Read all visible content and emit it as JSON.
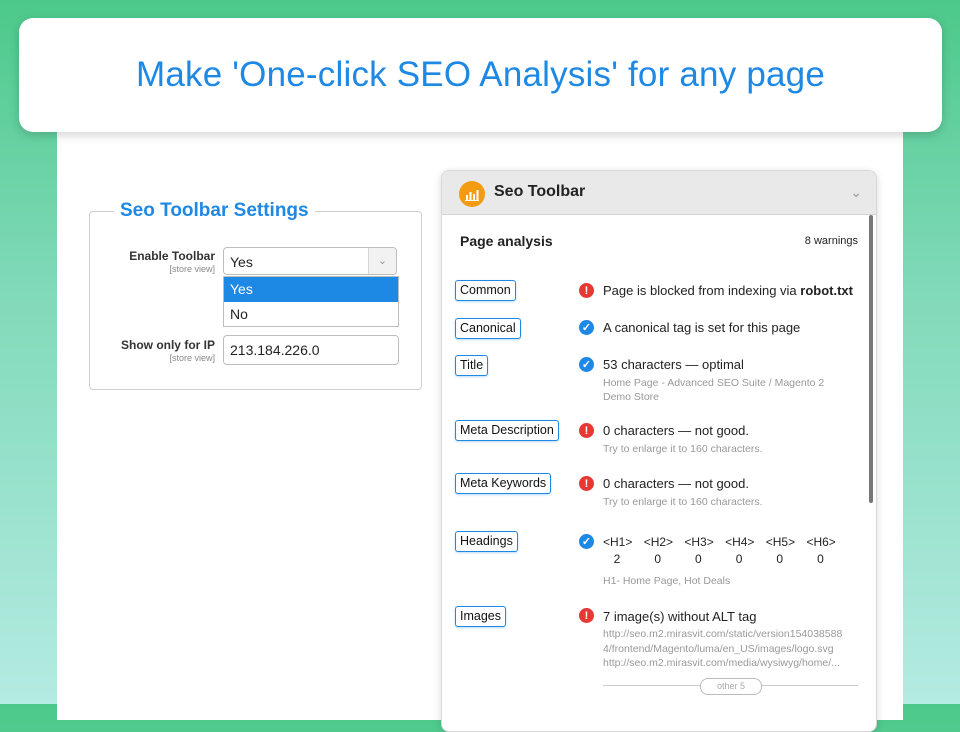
{
  "banner": {
    "title": "Make 'One-click SEO Analysis' for any page"
  },
  "settings": {
    "legend": "Seo Toolbar Settings",
    "enable_label": "Enable Toolbar",
    "enable_scope": "[store view]",
    "enable_value": "Yes",
    "enable_options": [
      "Yes",
      "No"
    ],
    "ip_label": "Show only for IP",
    "ip_scope": "[store view]",
    "ip_value": "213.184.226.0"
  },
  "toolbar": {
    "title": "Seo Toolbar",
    "section_title": "Page analysis",
    "warnings": "8 warnings",
    "rows": [
      {
        "label": "Common",
        "status": "error",
        "text_prefix": "Page is blocked from indexing via ",
        "text_bold": "robot.txt"
      },
      {
        "label": "Canonical",
        "status": "ok",
        "text": "A canonical tag is set for this page"
      },
      {
        "label": "Title",
        "status": "ok",
        "text": "53 characters — optimal",
        "sub": [
          "Home Page - Advanced SEO Suite / Magento 2",
          "Demo Store"
        ]
      },
      {
        "label": "Meta Description",
        "status": "error",
        "text": "0 characters — not good.",
        "sub": [
          "Try to enlarge it to 160 characters."
        ]
      },
      {
        "label": "Meta Keywords",
        "status": "error",
        "text": "0 characters — not good.",
        "sub": [
          "Try to enlarge it to 160 characters."
        ]
      },
      {
        "label": "Headings",
        "status": "ok",
        "sub": [
          "H1- Home Page, Hot Deals"
        ]
      },
      {
        "label": "Images",
        "status": "error",
        "text": "7 image(s) without ALT tag",
        "sub": [
          "http://seo.m2.mirasvit.com/static/version154038588",
          "4/frontend/Magento/luma/en_US/images/logo.svg",
          "http://seo.m2.mirasvit.com/media/wysiwyg/home/..."
        ]
      }
    ],
    "headings": [
      {
        "tag": "<H1>",
        "count": "2"
      },
      {
        "tag": "<H2>",
        "count": "0"
      },
      {
        "tag": "<H3>",
        "count": "0"
      },
      {
        "tag": "<H4>",
        "count": "0"
      },
      {
        "tag": "<H5>",
        "count": "0"
      },
      {
        "tag": "<H6>",
        "count": "0"
      }
    ],
    "other_label": "other 5"
  },
  "icons": {
    "error": "exclamation-icon",
    "ok": "checkmark-icon",
    "logo": "bar-chart-icon",
    "collapse": "chevron-down-icon"
  },
  "colors": {
    "accent": "#1e88e5",
    "error": "#e53935",
    "logo": "#f39c12"
  }
}
